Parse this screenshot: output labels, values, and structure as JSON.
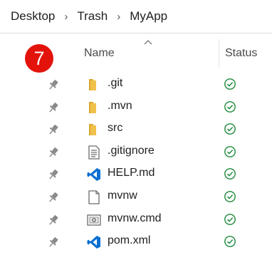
{
  "breadcrumb": {
    "items": [
      "Desktop",
      "Trash",
      "MyApp"
    ],
    "separator": "›"
  },
  "header": {
    "name_label": "Name",
    "status_label": "Status"
  },
  "badge": {
    "text": "7",
    "color": "#e3130b"
  },
  "files": [
    {
      "name": ".git",
      "icon": "folder-icon"
    },
    {
      "name": ".mvn",
      "icon": "folder-icon"
    },
    {
      "name": "src",
      "icon": "folder-icon"
    },
    {
      "name": ".gitignore",
      "icon": "text-file-icon"
    },
    {
      "name": "HELP.md",
      "icon": "vscode-icon"
    },
    {
      "name": "mvnw",
      "icon": "blank-file-icon"
    },
    {
      "name": "mvnw.cmd",
      "icon": "cmd-file-icon"
    },
    {
      "name": "pom.xml",
      "icon": "vscode-icon"
    }
  ],
  "colors": {
    "status": "#1e8a3c",
    "folder": "#f0c14b",
    "vscode": "#0a6fd1"
  }
}
